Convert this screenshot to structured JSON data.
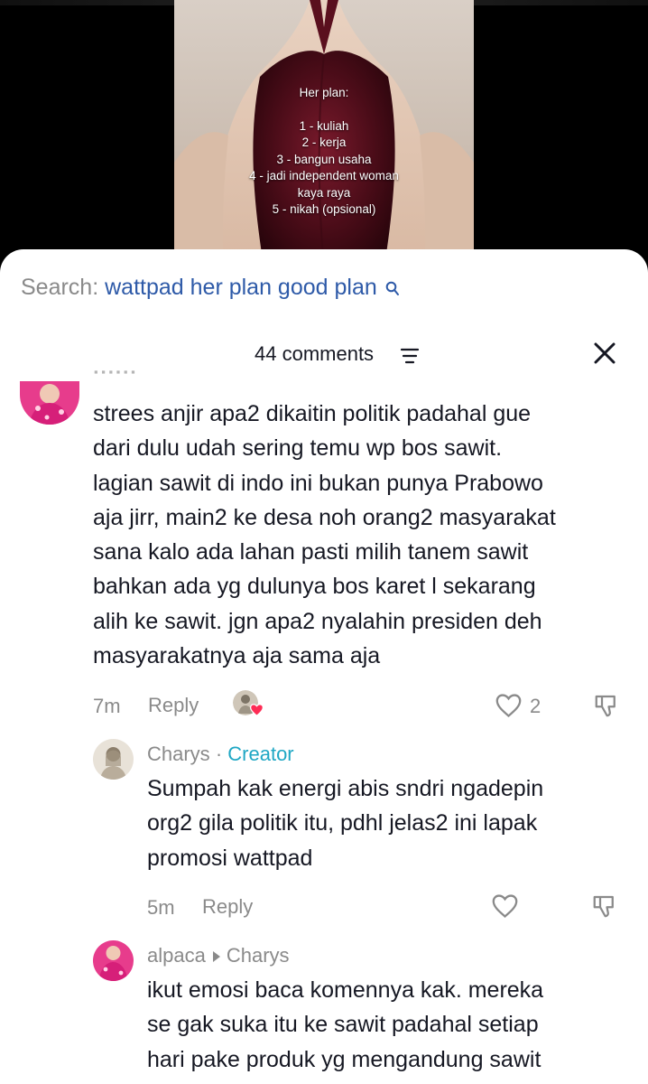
{
  "video": {
    "caption_title": "Her plan:",
    "caption_lines": [
      "1 - kuliah",
      "2 - kerja",
      "3 - bangun usaha",
      "4 - jadi independent woman",
      "kaya raya",
      "5 - nikah (opsional)"
    ]
  },
  "search": {
    "prefix": "Search:",
    "term": "wattpad her plan good plan",
    "icon": "search-icon"
  },
  "comments_header": {
    "title": "44 comments",
    "filter_icon": "filter-icon",
    "close_icon": "close-icon"
  },
  "comments": [
    {
      "text_lines": [
        "strees anjir apa2 dikaitin politik padahal gue",
        "dari dulu udah sering temu wp bos sawit.",
        "lagian sawit di indo ini bukan punya Prabowo",
        "aja jirr, main2 ke desa noh orang2 masyarakat",
        "sana kalo ada lahan pasti milih tanem sawit",
        "bahkan ada yg dulunya bos karet l sekarang",
        "alih ke sawit. jgn apa2 nyalahin presiden deh",
        "masyarakatnya aja sama aja"
      ],
      "time": "7m",
      "reply_label": "Reply",
      "like_count": "2"
    }
  ],
  "replies": [
    {
      "author": "Charys",
      "badge": "Creator",
      "separator": "·",
      "text_lines": [
        "Sumpah kak energi abis sndri ngadepin",
        "org2 gila politik itu, pdhl jelas2 ini lapak",
        "promosi wattpad"
      ],
      "time": "5m",
      "reply_label": "Reply"
    },
    {
      "author": "alpaca",
      "reply_to": "Charys",
      "text_lines": [
        "ikut emosi baca komennya kak. mereka",
        "se gak suka itu ke sawit padahal setiap",
        "hari pake produk yg mengandung sawit"
      ]
    }
  ],
  "colors": {
    "link_blue": "#2e5aa8",
    "creator_teal": "#1fa7c4",
    "muted_gray": "#8a8a8a",
    "text_dark": "#161823",
    "heart_red": "#fe2c55",
    "dress_red": "#6b1224"
  }
}
